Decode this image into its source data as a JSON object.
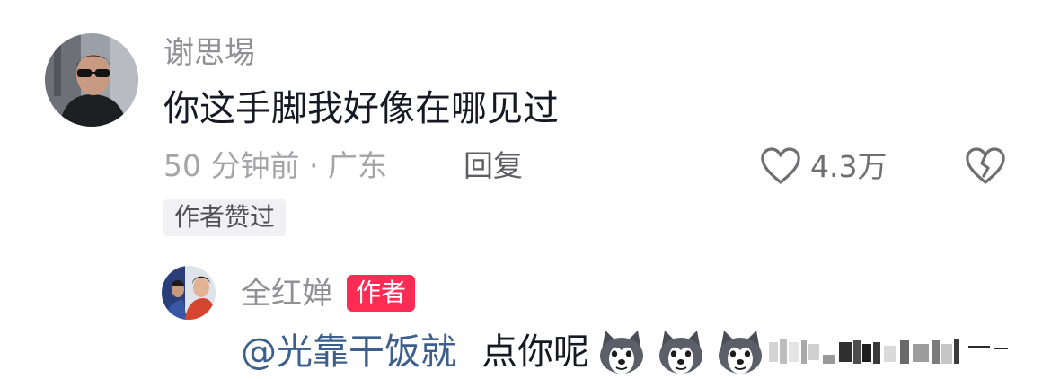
{
  "comment": {
    "author": "谢思埸",
    "text": "你这手脚我好像在哪见过",
    "time_location": "50 分钟前 · 广东",
    "reply_label": "回复",
    "like_count": "4.3万",
    "author_liked_badge": "作者赞过"
  },
  "reply": {
    "author": "全红婵",
    "author_tag": "作者",
    "mention": "@光靠干饭就",
    "text": "点你呢"
  },
  "icons": {
    "like": "heart-outline-icon",
    "dislike": "broken-heart-icon",
    "emoji": "husky-dog-emoji"
  },
  "colors": {
    "accent_red": "#fe2c55",
    "mention_blue": "#3c5f8c"
  }
}
